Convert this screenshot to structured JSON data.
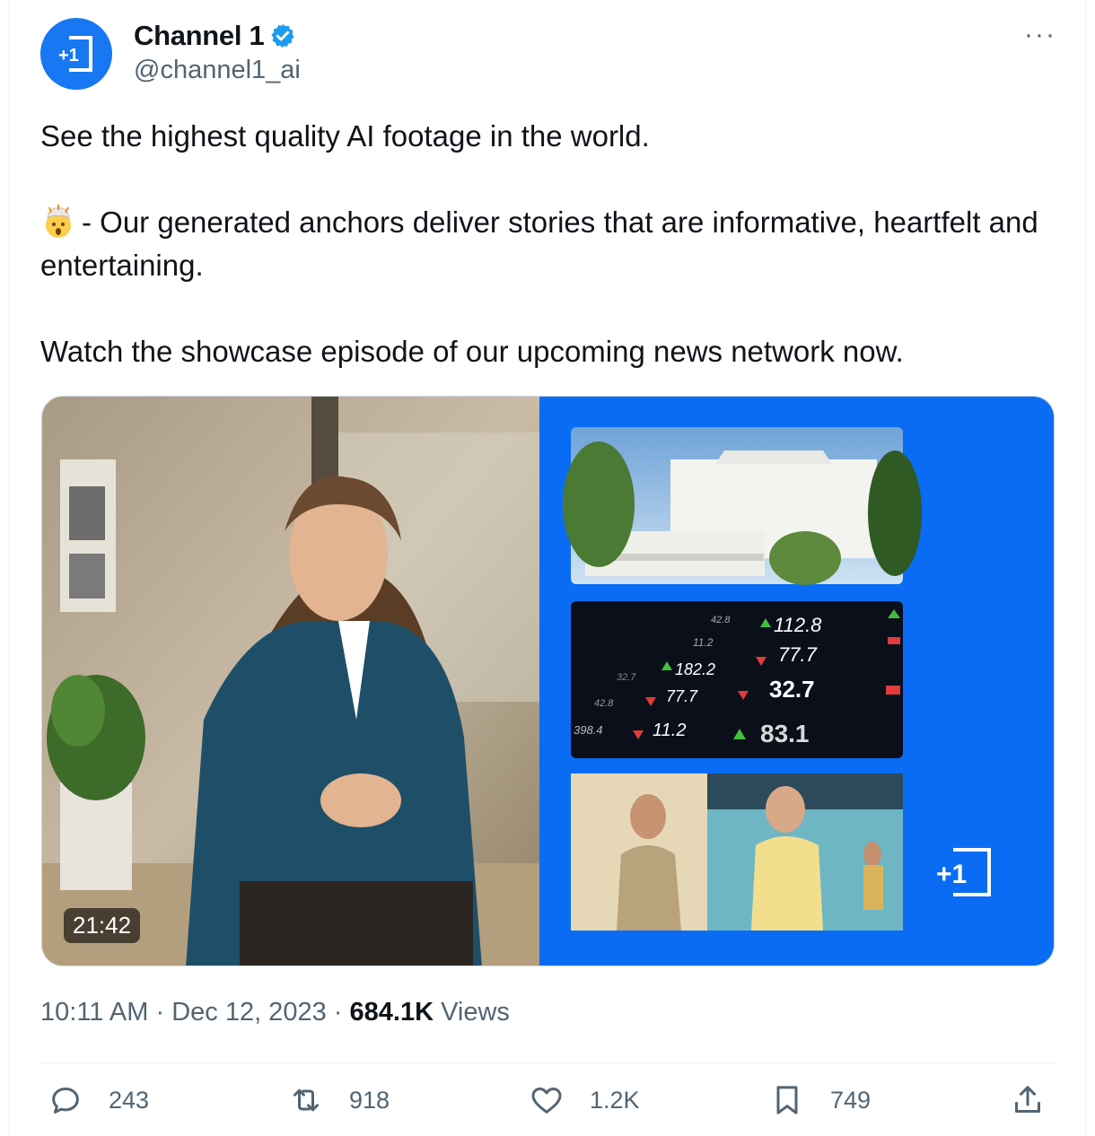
{
  "author": {
    "display_name": "Channel 1",
    "handle": "@channel1_ai",
    "avatar_text": "+1",
    "brand_color": "#1877f2",
    "verified_color": "#1d9bf0"
  },
  "more_label": "···",
  "post": {
    "line1": "See the highest quality AI footage in the world.",
    "line2_emoji": "exploding-head-emoji",
    "line2": "- Our generated anchors deliver stories that are informative, heartfelt and entertaining.",
    "line3": "Watch the showcase episode of our upcoming news network now."
  },
  "media": {
    "duration": "21:42",
    "logo_text": "+1",
    "ticker_values": [
      "112.8",
      "77.7",
      "32.7",
      "83.1",
      "182.2",
      "77.7",
      "11.2",
      "11.2",
      "42.8",
      "398.4",
      "42.8",
      "32.7"
    ]
  },
  "meta": {
    "time": "10:11 AM",
    "separator": "·",
    "date": "Dec 12, 2023",
    "views_count": "684.1K",
    "views_label": "Views"
  },
  "actions": {
    "replies": "243",
    "reposts": "918",
    "likes": "1.2K",
    "bookmarks": "749"
  }
}
